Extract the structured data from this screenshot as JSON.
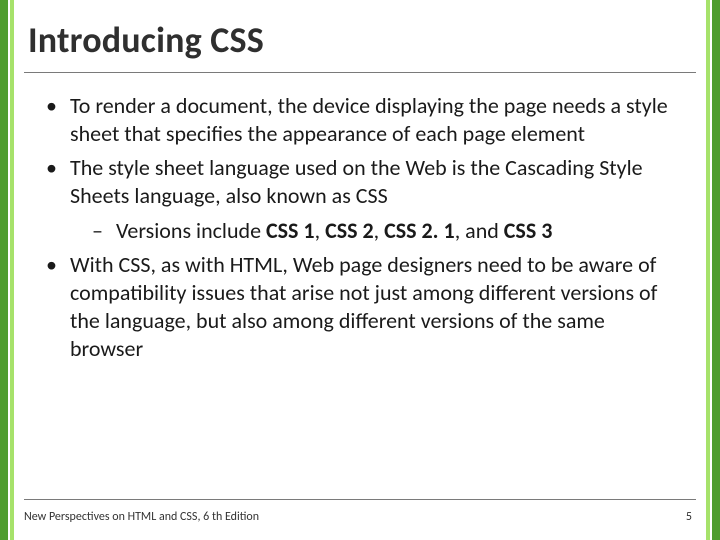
{
  "title": "Introducing CSS",
  "bullets": {
    "b1": "To render a document, the device displaying the page needs a style sheet that specifies the appearance of each page element",
    "b2": "The style sheet language used on the Web is the Cascading Style Sheets language, also known as CSS",
    "b2_sub_prefix": "Versions include ",
    "b2_v1": "CSS 1",
    "b2_sep": ", ",
    "b2_v2": "CSS 2",
    "b2_v3": "CSS 2. 1",
    "b2_and": ", and ",
    "b2_v4": "CSS 3",
    "b3": "With CSS, as with HTML, Web page designers need to be aware of compatibility issues that arise not just among different versions of the language, but also among different versions of the same browser"
  },
  "footer": {
    "left": "New Perspectives on HTML and CSS, 6 th Edition",
    "page": "5"
  },
  "glyphs": {
    "bullet": "•",
    "dash": "–"
  }
}
